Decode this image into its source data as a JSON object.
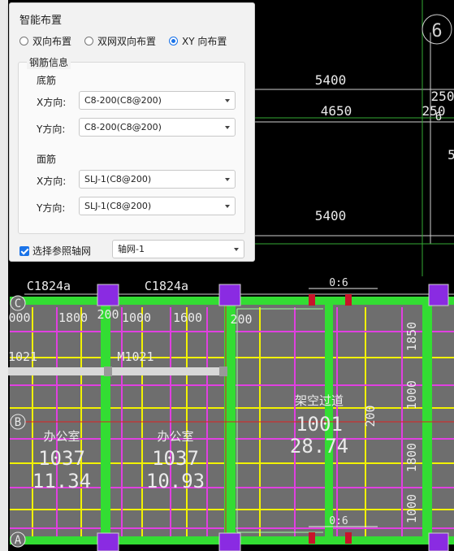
{
  "panel": {
    "title": "智能布置",
    "modes": [
      "双向布置",
      "双网双向布置",
      "XY 向布置"
    ],
    "selected_mode": 2,
    "group_title": "钢筋信息",
    "bottom": {
      "title": "底筋",
      "x_label": "X方向:",
      "x_value": "C8-200(C8@200)",
      "y_label": "Y方向:",
      "y_value": "C8-200(C8@200)"
    },
    "top": {
      "title": "面筋",
      "x_label": "X方向:",
      "x_value": "SLJ-1(C8@200)",
      "y_label": "Y方向:",
      "y_value": "SLJ-1(C8@200)"
    },
    "ref_axis_label": "选择参照轴网",
    "ref_axis_checked": true,
    "ref_axis_value": "轴网-1"
  },
  "cad": {
    "dims": {
      "d5400_top": "5400",
      "d4650": "4650",
      "d250a": "250",
      "d250b": "250",
      "d5400_mid": "5400",
      "d1800a": "1800",
      "d1000a": "1000",
      "d1600": "1600",
      "d200a": "200",
      "d200b": "200",
      "d000": "000",
      "d1850": "1850",
      "d1000b": "1000",
      "d1800b": "1800",
      "d1000c": "1000",
      "d2000": "200"
    },
    "axis_labels": {
      "c": "C",
      "b": "B",
      "a": "A",
      "six": "6",
      "six_small": "6"
    },
    "windows": {
      "w1": "C1824a",
      "w2": "C1824a"
    },
    "doors": {
      "d1": "M1021",
      "d2": "1021"
    },
    "tags": {
      "t1": "0:6",
      "t2": "0:6"
    },
    "rooms": [
      {
        "name": "办公室",
        "code": "1037",
        "area": "11.34"
      },
      {
        "name": "办公室",
        "code": "1037",
        "area": "10.93"
      },
      {
        "name": "架空过道",
        "code": "1001",
        "area": "28.74"
      }
    ],
    "edge_digit": "5"
  },
  "colors": {
    "green": "#33dd33",
    "magenta": "#e040e0",
    "yellow": "#f2f200",
    "purple": "#8a2be2",
    "red": "#e02020",
    "slab": "#6e6e6e"
  }
}
